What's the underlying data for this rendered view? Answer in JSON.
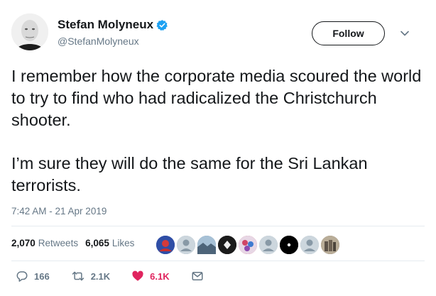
{
  "author": {
    "display_name": "Stefan Molyneux",
    "handle": "@StefanMolyneux",
    "verified": true,
    "verified_color": "#1da1f2"
  },
  "follow_button": {
    "label": "Follow"
  },
  "tweet": {
    "paragraphs": [
      "I remember how the corporate media scoured the world to try to find who had radicalized the Christchurch shooter.",
      "I’m sure they will do the same for the Sri Lankan terrorists."
    ],
    "timestamp": "7:42 AM - 21 Apr 2019"
  },
  "stats": {
    "retweets_count": "2,070",
    "retweets_label": "Retweets",
    "likes_count": "6,065",
    "likes_label": "Likes"
  },
  "liked_by_avatars": [
    {
      "icon": "blue-red-avatar",
      "color": "#3b5bb8"
    },
    {
      "icon": "default-egg-avatar",
      "color": "#aab8c2"
    },
    {
      "icon": "landscape-avatar",
      "color": "#6d8aa8"
    },
    {
      "icon": "dark-symbol-avatar",
      "color": "#222222"
    },
    {
      "icon": "colorful-avatar",
      "color": "#c64b6a"
    },
    {
      "icon": "default-egg-avatar",
      "color": "#aab8c2"
    },
    {
      "icon": "black-dot-avatar",
      "color": "#000000"
    },
    {
      "icon": "default-egg-avatar",
      "color": "#aab8c2"
    },
    {
      "icon": "photo-avatar",
      "color": "#8a7d6a"
    }
  ],
  "actions": {
    "reply_count": "166",
    "retweet_count": "2.1K",
    "like_count": "6.1K",
    "like_color": "#e0245e"
  },
  "colors": {
    "text": "#14171a",
    "secondary": "#657786",
    "divider": "#e6ecf0"
  }
}
